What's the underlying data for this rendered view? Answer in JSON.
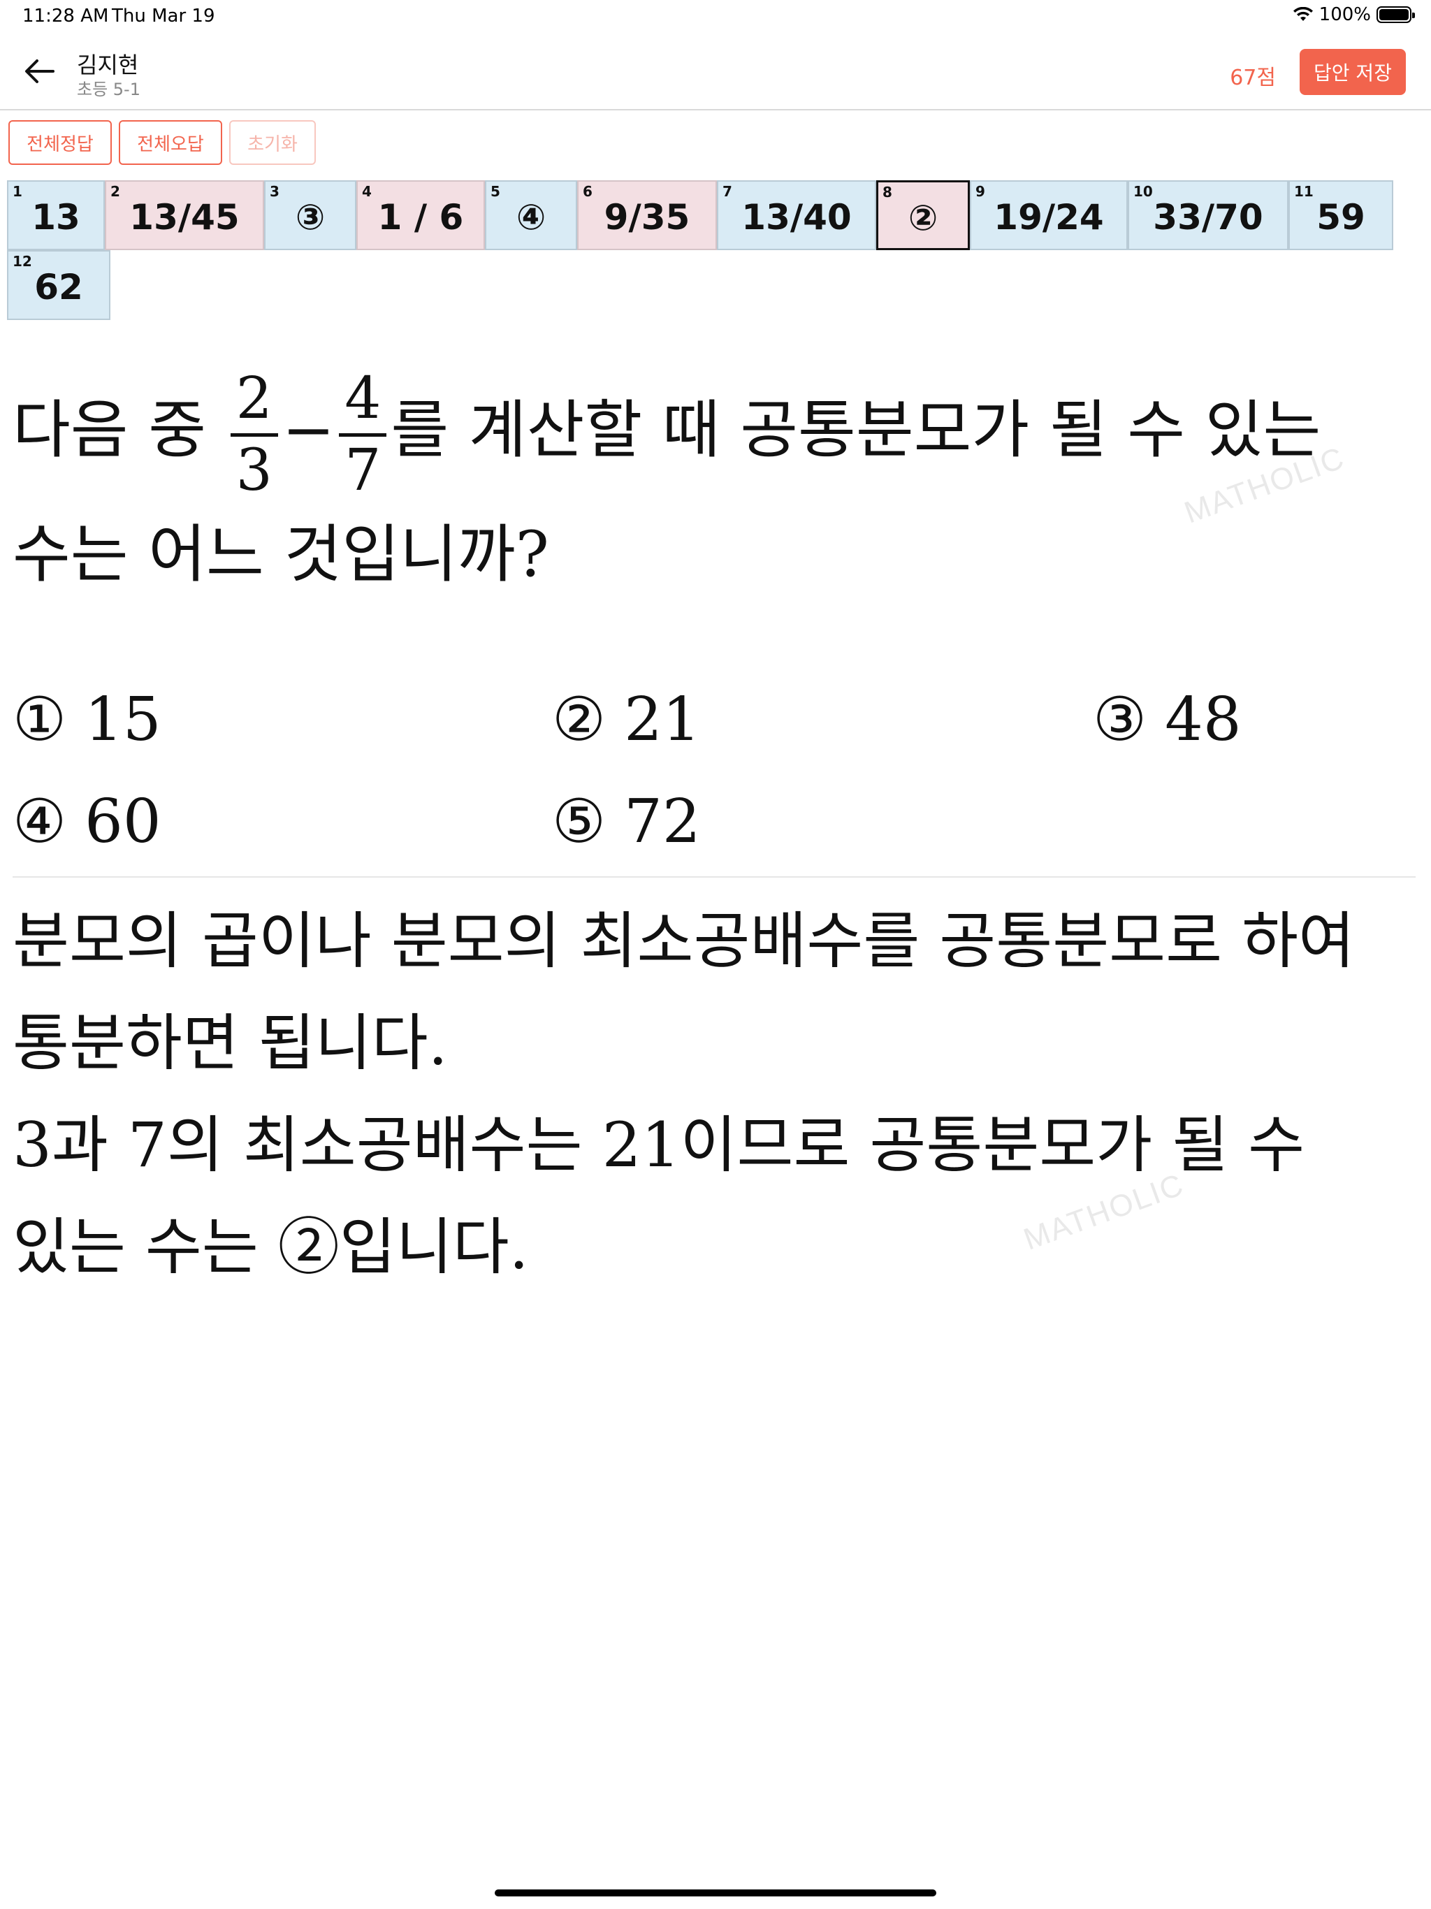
{
  "status": {
    "time": "11:28 AM",
    "date": "Thu Mar 19",
    "battery": "100%",
    "battery_level": 1.0
  },
  "header": {
    "back_icon": "arrow-left-icon",
    "name": "김지현",
    "class": "초등 5-1",
    "score": "67점",
    "save_label": "답안 저장",
    "accent": "#f2644d"
  },
  "actions": {
    "all_correct": "전체정답",
    "all_wrong": "전체오답",
    "reset": "초기화"
  },
  "answers": [
    {
      "num": "1",
      "value": "13",
      "status": "correct"
    },
    {
      "num": "2",
      "value": "13/45",
      "status": "wrong"
    },
    {
      "num": "3",
      "value": "③",
      "status": "correct"
    },
    {
      "num": "4",
      "value": "1 / 6",
      "status": "wrong"
    },
    {
      "num": "5",
      "value": "④",
      "status": "correct"
    },
    {
      "num": "6",
      "value": "9/35",
      "status": "wrong"
    },
    {
      "num": "7",
      "value": "13/40",
      "status": "correct"
    },
    {
      "num": "8",
      "value": "②",
      "status": "wrong",
      "selected": true
    },
    {
      "num": "9",
      "value": "19/24",
      "status": "correct"
    },
    {
      "num": "10",
      "value": "33/70",
      "status": "correct"
    },
    {
      "num": "11",
      "value": "59",
      "status": "correct"
    },
    {
      "num": "12",
      "value": "62",
      "status": "correct"
    }
  ],
  "problem": {
    "prefix": "다음 중",
    "frac1": {
      "num": "2",
      "den": "3"
    },
    "op": "−",
    "frac2": {
      "num": "4",
      "den": "7"
    },
    "suffix": "를 계산할 때 공통분모가 될 수 있는",
    "line2": "수는 어느 것입니까?",
    "choices": [
      {
        "mark": "①",
        "value": "15"
      },
      {
        "mark": "②",
        "value": "21"
      },
      {
        "mark": "③",
        "value": "48"
      },
      {
        "mark": "④",
        "value": "60"
      },
      {
        "mark": "⑤",
        "value": "72"
      }
    ]
  },
  "explanation": {
    "lines": [
      "분모의 곱이나 분모의 최소공배수를 공통분모로 하여",
      "통분하면 됩니다.",
      "3과 7의 최소공배수는 21이므로 공통분모가 될 수",
      "있는 수는 ②입니다."
    ]
  },
  "watermark": "MATHOLIC"
}
